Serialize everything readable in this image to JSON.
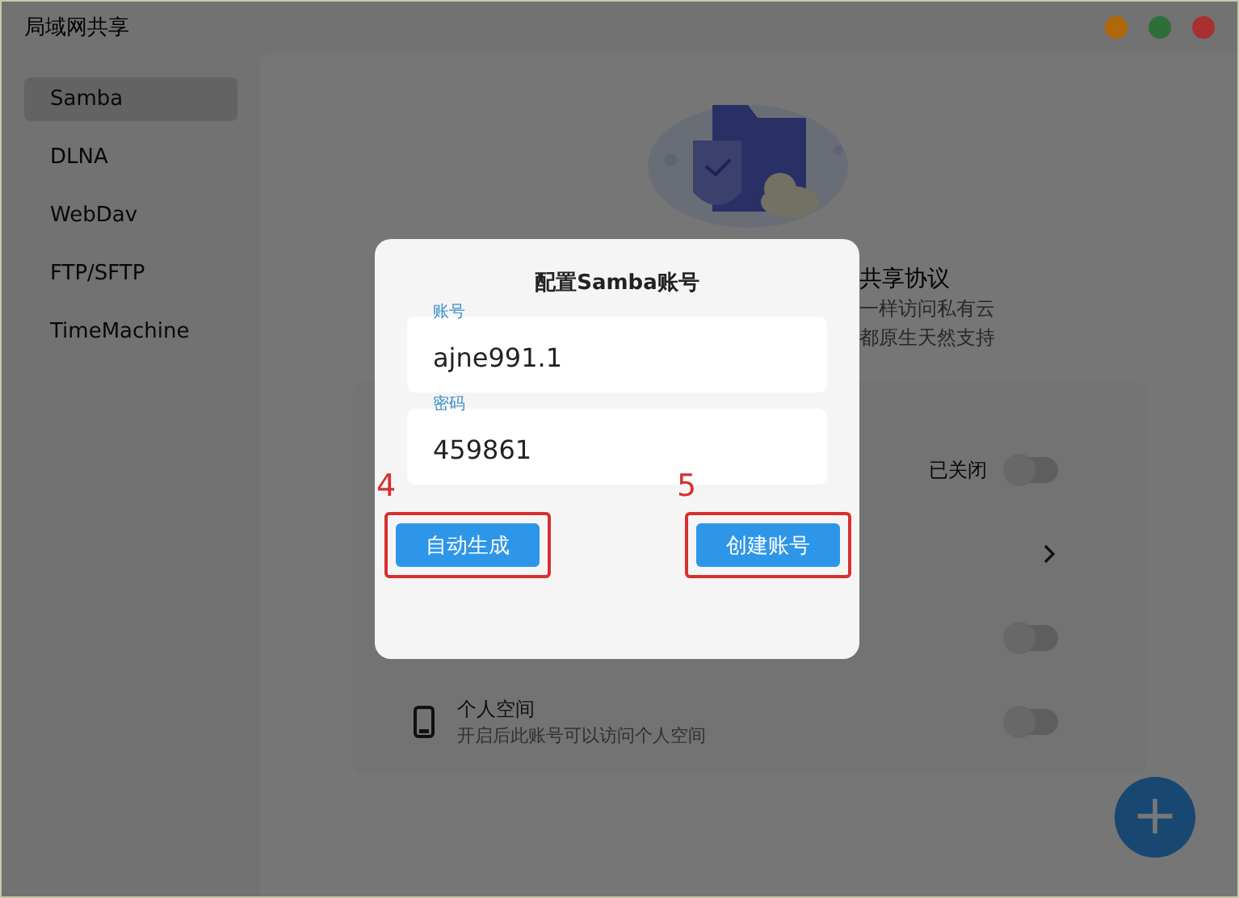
{
  "window": {
    "title": "局域网共享",
    "controls": [
      {
        "color": "#b0680a"
      },
      {
        "color": "#2e6e38"
      },
      {
        "color": "#a83030"
      }
    ]
  },
  "sidebar": {
    "items": [
      {
        "label": "Samba",
        "selected": true
      },
      {
        "label": "DLNA",
        "selected": false
      },
      {
        "label": "WebDav",
        "selected": false
      },
      {
        "label": "FTP/SFTP",
        "selected": false
      },
      {
        "label": "TimeMachine",
        "selected": false
      }
    ]
  },
  "main": {
    "heading": "共享协议",
    "description_lines": [
      "一样访问私有云",
      "都原生天然支持"
    ],
    "rows": [
      {
        "kind": "toggle",
        "status": "已关闭",
        "on": false
      },
      {
        "kind": "link"
      },
      {
        "kind": "toggle",
        "on": false
      },
      {
        "kind": "toggle",
        "title": "个人空间",
        "subtitle": "开启后此账号可以访问个人空间",
        "on": false
      }
    ],
    "fab": {
      "label": "+"
    }
  },
  "dialog": {
    "title": "配置Samba账号",
    "fields": [
      {
        "label": "账号",
        "value": "ajne991.1"
      },
      {
        "label": "密码",
        "value": "459861"
      }
    ],
    "buttons": [
      {
        "label": "自动生成",
        "annotation": "4"
      },
      {
        "label": "创建账号",
        "annotation": "5"
      }
    ]
  }
}
